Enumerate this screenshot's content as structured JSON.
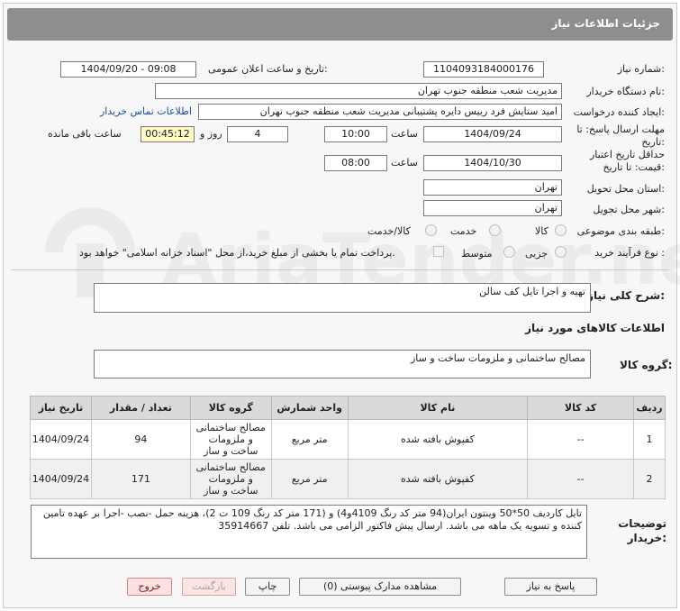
{
  "header": {
    "title": "جزئیات اطلاعات نیاز"
  },
  "form": {
    "need_number_label": "شماره نیاز:",
    "need_number": "1104093184000176",
    "announce_label": "تاریخ و ساعت اعلان عمومی:",
    "announce_value": "1404/09/20 - 09:08",
    "buyer_org_label": "نام دستگاه خریدار:",
    "buyer_org": "مدیریت شعب منطقه جنوب تهران",
    "requester_label": "ایجاد کننده درخواست:",
    "requester": "امید ستایش فرد رییس دایره پشتیبانی مدیریت شعب منطقه جنوب تهران",
    "contact_link": "اطلاعات تماس خریدار",
    "reply_deadline_label": "مهلت ارسال پاسخ: تا تاریخ:",
    "reply_date": "1404/09/24",
    "time_label": "ساعت",
    "reply_time": "10:00",
    "days": "4",
    "days_label": "روز و",
    "remaining_time": "00:45:12",
    "remaining_label": "ساعت باقی مانده",
    "price_validity_label": "حداقل تاریخ اعتبار قیمت: تا تاریخ:",
    "validity_date": "1404/10/30",
    "validity_time": "08:00",
    "delivery_province_label": "استان محل تحویل:",
    "delivery_province": "تهران",
    "delivery_city_label": "شهر محل تحویل:",
    "delivery_city": "تهران",
    "category_label": "طبقه بندی موضوعی:",
    "category_options": [
      "کالا",
      "خدمت",
      "کالا/خدمت"
    ],
    "process_label": "نوع فرآیند خرید :",
    "process_options": [
      "جزیی",
      "متوسط"
    ],
    "payment_note": "پرداخت تمام یا بخشی از مبلغ خرید،از محل \"اسناد خزانه اسلامی\" خواهد بود."
  },
  "summary": {
    "label": "شرح کلی نیاز:",
    "value": "تهیه و اجرا تایل کف سالن"
  },
  "goods": {
    "section_title": "اطلاعات کالاهای مورد نیاز",
    "group_label": "گروه کالا:",
    "group_value": "مصالح ساختمانی و ملزومات ساخت و ساز",
    "columns": [
      "ردیف",
      "کد کالا",
      "نام کالا",
      "واحد شمارش",
      "گروه کالا",
      "تعداد / مقدار",
      "تاریخ نیاز"
    ],
    "rows": [
      {
        "row": "1",
        "code": "--",
        "name": "کفپوش بافته شده",
        "unit": "متر مربع",
        "group": "مصالح ساختمانی و ملزومات ساخت و ساز",
        "qty": "94",
        "date": "1404/09/24"
      },
      {
        "row": "2",
        "code": "--",
        "name": "کفپوش بافته شده",
        "unit": "متر مربع",
        "group": "مصالح ساختمانی و ملزومات ساخت و ساز",
        "qty": "171",
        "date": "1404/09/24"
      }
    ]
  },
  "buyer_notes": {
    "label": "توضیحات خریدار:",
    "value": "تایل کاردیف 50*50 وینتون ایران(94 متر کد رنگ 4109و4) و (171 متر کد رنگ 109 ت 2)، هزینه حمل -نصب -اجرا بر عهده تامین کننده و تسویه یک ماهه می باشد. ارسال پیش فاکتور الزامی می باشد. تلفن 35914667"
  },
  "buttons": {
    "reply": "پاسخ به نیاز",
    "attachments": "مشاهده مدارک پیوستی (0)",
    "print": "چاپ",
    "back": "بازگشت",
    "exit": "خروج"
  },
  "watermark": {
    "text": "AriaTender.net"
  },
  "colors": {
    "header_bg": "#8e8e8e",
    "link": "#1b4fa8",
    "remaining_bg": "#fff9c4"
  }
}
